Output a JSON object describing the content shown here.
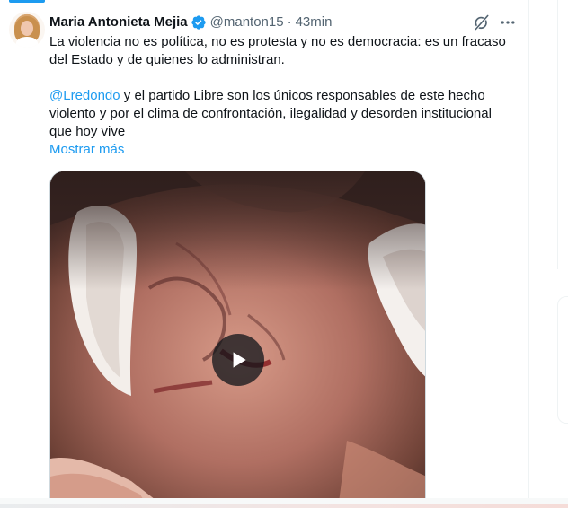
{
  "tweet": {
    "author_name": "Maria Antonieta Mejia",
    "author_handle": "@manton15",
    "separator": "·",
    "time": "43min",
    "paragraph1": [
      "La violencia no es política, no es protesta y no es democracia: es un fracaso",
      "del Estado y de quienes lo administran."
    ],
    "paragraph2_mention": "@Lredondo",
    "paragraph2_line1_rest": " y el partido Libre son los únicos responsables de este hecho",
    "paragraph2_line2": "violento y por el clima de confrontación, ilegalidad y desorden institucional",
    "paragraph2_line3": "que hoy vive",
    "show_more": "Mostrar más"
  },
  "icons": {
    "verified": "verified-badge-icon",
    "grok": "grok-icon",
    "more": "more-options-icon",
    "play": "play-icon"
  },
  "colors": {
    "accent": "#1d9bf0",
    "text": "#0f1419",
    "muted": "#536471",
    "border": "#cfd9de"
  }
}
